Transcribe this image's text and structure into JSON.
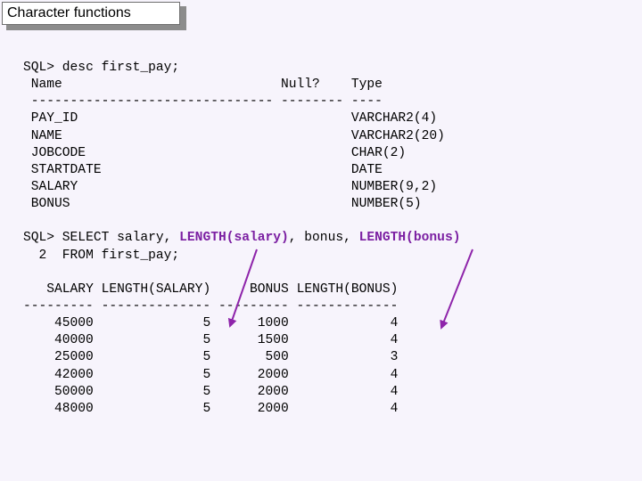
{
  "slide": {
    "title": "Character functions"
  },
  "desc": {
    "prompt": "SQL> ",
    "command": "desc first_pay;",
    "headers": {
      "name": "Name",
      "null": "Null?",
      "type": "Type"
    },
    "separator": "------------------------------- -------- ----",
    "rows": [
      {
        "name": "PAY_ID",
        "type": "VARCHAR2(4)"
      },
      {
        "name": "NAME",
        "type": "VARCHAR2(20)"
      },
      {
        "name": "JOBCODE",
        "type": "CHAR(2)"
      },
      {
        "name": "STARTDATE",
        "type": "DATE"
      },
      {
        "name": "SALARY",
        "type": "NUMBER(9,2)"
      },
      {
        "name": "BONUS",
        "type": "NUMBER(5)"
      }
    ]
  },
  "query": {
    "prompt": "SQL> ",
    "select_kw": "SELECT salary, ",
    "fn1": "LENGTH(salary)",
    "mid": ", bonus, ",
    "fn2": "LENGTH(bonus)",
    "line2_num": "2",
    "line2": "FROM first_pay;",
    "highlight_color": "#7b1fa2"
  },
  "result": {
    "headers": [
      "SALARY",
      "LENGTH(SALARY)",
      "BONUS",
      "LENGTH(BONUS)"
    ],
    "separator": "--------- -------------- --------- -------------",
    "rows": [
      [
        "45000",
        "5",
        "1000",
        "4"
      ],
      [
        "40000",
        "5",
        "1500",
        "4"
      ],
      [
        "25000",
        "5",
        "500",
        "3"
      ],
      [
        "42000",
        "5",
        "2000",
        "4"
      ],
      [
        "50000",
        "5",
        "2000",
        "4"
      ],
      [
        "48000",
        "5",
        "2000",
        "4"
      ]
    ]
  }
}
